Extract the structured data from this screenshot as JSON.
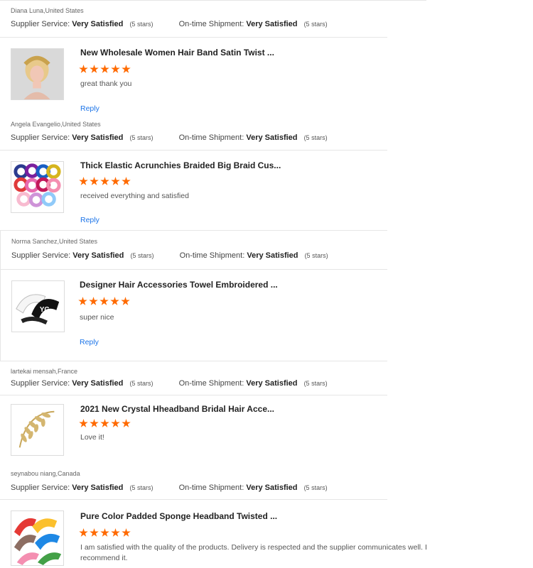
{
  "labels": {
    "supplier_service": "Supplier Service:",
    "ontime_shipment": "On-time Shipment:",
    "reply": "Reply"
  },
  "star_color": "#ff6a00",
  "reviews": [
    {
      "buyer": "Diana Luna,United States",
      "supplier_value": "Very Satisfied",
      "supplier_stars": "(5 stars)",
      "shipment_value": "Very Satisfied",
      "shipment_stars": "(5 stars)",
      "product_title": "New Wholesale Women Hair Band Satin Twist ...",
      "rating": 5,
      "comment": "great thank you",
      "thumbnail_icon": "blonde-braid-headband-photo"
    },
    {
      "buyer": "Angela Evangelio,United States",
      "supplier_value": "Very Satisfied",
      "supplier_stars": "(5 stars)",
      "shipment_value": "Very Satisfied",
      "shipment_stars": "(5 stars)",
      "product_title": "Thick Elastic Acrunchies Braided Big Braid Cus...",
      "rating": 5,
      "comment": "received everything and satisfied",
      "thumbnail_icon": "colorful-scrunchies-photo"
    },
    {
      "buyer": "Norma Sanchez,United States",
      "supplier_value": "Very Satisfied",
      "supplier_stars": "(5 stars)",
      "shipment_value": "Very Satisfied",
      "shipment_stars": "(5 stars)",
      "product_title": "Designer Hair Accessories Towel Embroidered ...",
      "rating": 5,
      "comment": "super nice",
      "thumbnail_icon": "black-white-headbands-photo"
    },
    {
      "buyer": "lartekai mensah,France",
      "supplier_value": "Very Satisfied",
      "supplier_stars": "(5 stars)",
      "shipment_value": "Very Satisfied",
      "shipment_stars": "(5 stars)",
      "product_title": "2021 New Crystal Hheadband Bridal Hair Acce...",
      "rating": 5,
      "comment": "Love it!",
      "thumbnail_icon": "gold-leaf-headband-photo"
    },
    {
      "buyer": "seynabou niang,Canada",
      "supplier_value": "Very Satisfied",
      "supplier_stars": "(5 stars)",
      "shipment_value": "Very Satisfied",
      "shipment_stars": "(5 stars)",
      "product_title": "Pure Color Padded Sponge Headband Twisted ...",
      "rating": 5,
      "comment": "I am satisfied with the quality of the products. Delivery is respected and the supplier communicates well. I recommend it.",
      "thumbnail_icon": "padded-headbands-photo"
    }
  ]
}
